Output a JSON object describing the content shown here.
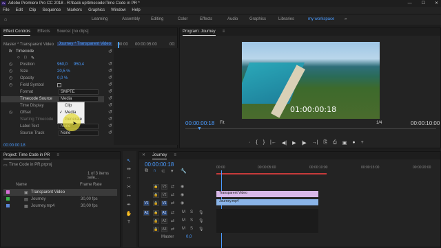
{
  "window": {
    "title": "Adobe Premiere Pro CC 2018 - R:\\back up\\timecode\\Time Code in PR *",
    "app_icon": "Pr",
    "controls": [
      "—",
      "☐",
      "✕"
    ]
  },
  "menu": [
    "File",
    "Edit",
    "Clip",
    "Sequence",
    "Markers",
    "Graphics",
    "Window",
    "Help"
  ],
  "workspaces": {
    "items": [
      "Learning",
      "Assembly",
      "Editing",
      "Color",
      "Effects",
      "Audio",
      "Graphics",
      "Libraries",
      "my workspace"
    ],
    "active": "my workspace",
    "more": "»"
  },
  "effect_controls": {
    "tabs": [
      "Effect Controls",
      "Effects",
      "Source: [no clips]"
    ],
    "menu_icon": "≡",
    "master": "Master * Transparent Video",
    "clip": "Journey * Transparent Video",
    "ruler_start": ":00:00",
    "ruler_mid": "00:00:05:00",
    "ruler_end": "00:",
    "fx_label": "fx",
    "effect_name": "Timecode",
    "properties": [
      {
        "name": "Position",
        "value": "960,0",
        "value2": "950,4"
      },
      {
        "name": "Size",
        "value": "20,5 %"
      },
      {
        "name": "Opacity",
        "value": "0,0 %"
      },
      {
        "name": "Field Symbol"
      },
      {
        "name": "Format",
        "dropdown": "SMPTE"
      },
      {
        "name": "Timecode Source",
        "dropdown": "Media"
      },
      {
        "name": "Time Display",
        "dropdown": ""
      },
      {
        "name": "Offset",
        "value": ""
      },
      {
        "name": "Starting Timecode",
        "value": ""
      },
      {
        "name": "Label Text",
        "dropdown": "None"
      },
      {
        "name": "Source Track",
        "dropdown": "None"
      }
    ],
    "popup_options": [
      "Clip",
      "Media",
      "Generate"
    ],
    "popup_selected": "Media",
    "current_time": "00:00:00:18"
  },
  "program": {
    "title": "Program: Journey",
    "menu_icon": "≡",
    "overlay_timecode": "01:00:00:18",
    "current_time": "00:00:00:18",
    "fit": "Fit",
    "fraction": "1/4",
    "duration": "00:00:10:00",
    "transport": [
      "·",
      "{",
      "}",
      "|←",
      "◀|",
      "▶",
      "|▶",
      "→|",
      "⎘",
      "⎙",
      "▣",
      "●",
      "+"
    ]
  },
  "project": {
    "title": "Project: Time Code in PR",
    "menu_icon": "≡",
    "file": "Time Code in PR.prproj",
    "count": "1 of 3 items sele...",
    "headers": {
      "name": "Name",
      "rate": "Frame Rate"
    },
    "items": [
      {
        "name": "Transparent Video",
        "rate": "",
        "color": "#d86fd8"
      },
      {
        "name": "Journey",
        "rate": "30,00 fps",
        "color": "#3ab24a"
      },
      {
        "name": "Journey.mp4",
        "rate": "30,00 fps",
        "color": "#5a86d8"
      }
    ]
  },
  "timeline": {
    "tab": "Journey",
    "menu_icon": "≡",
    "current_time": "00:00:00:18",
    "ruler": [
      "00:00",
      "00:00:05:00",
      "00:00:10:00",
      "00:00:15:00",
      "00:00:20:00",
      "00:00:"
    ],
    "video_tracks": [
      "V3",
      "V2",
      "V1"
    ],
    "audio_tracks": [
      "A1",
      "A2",
      "A3"
    ],
    "source_patch_v": "V1",
    "source_patch_a": "A1",
    "master": "Master",
    "master_value": "0,0",
    "clips": [
      {
        "name": "Transparent Video",
        "color": "#d8b8e8"
      },
      {
        "name": "Journey.mp4",
        "color": "#8ab4e8"
      }
    ]
  },
  "tools": [
    "↖",
    "⇹",
    "↔",
    "✂",
    "↦",
    "✒",
    "✋",
    "T"
  ],
  "colors": {
    "accent": "#4a9bff",
    "highlight": "#e6dc3c"
  }
}
